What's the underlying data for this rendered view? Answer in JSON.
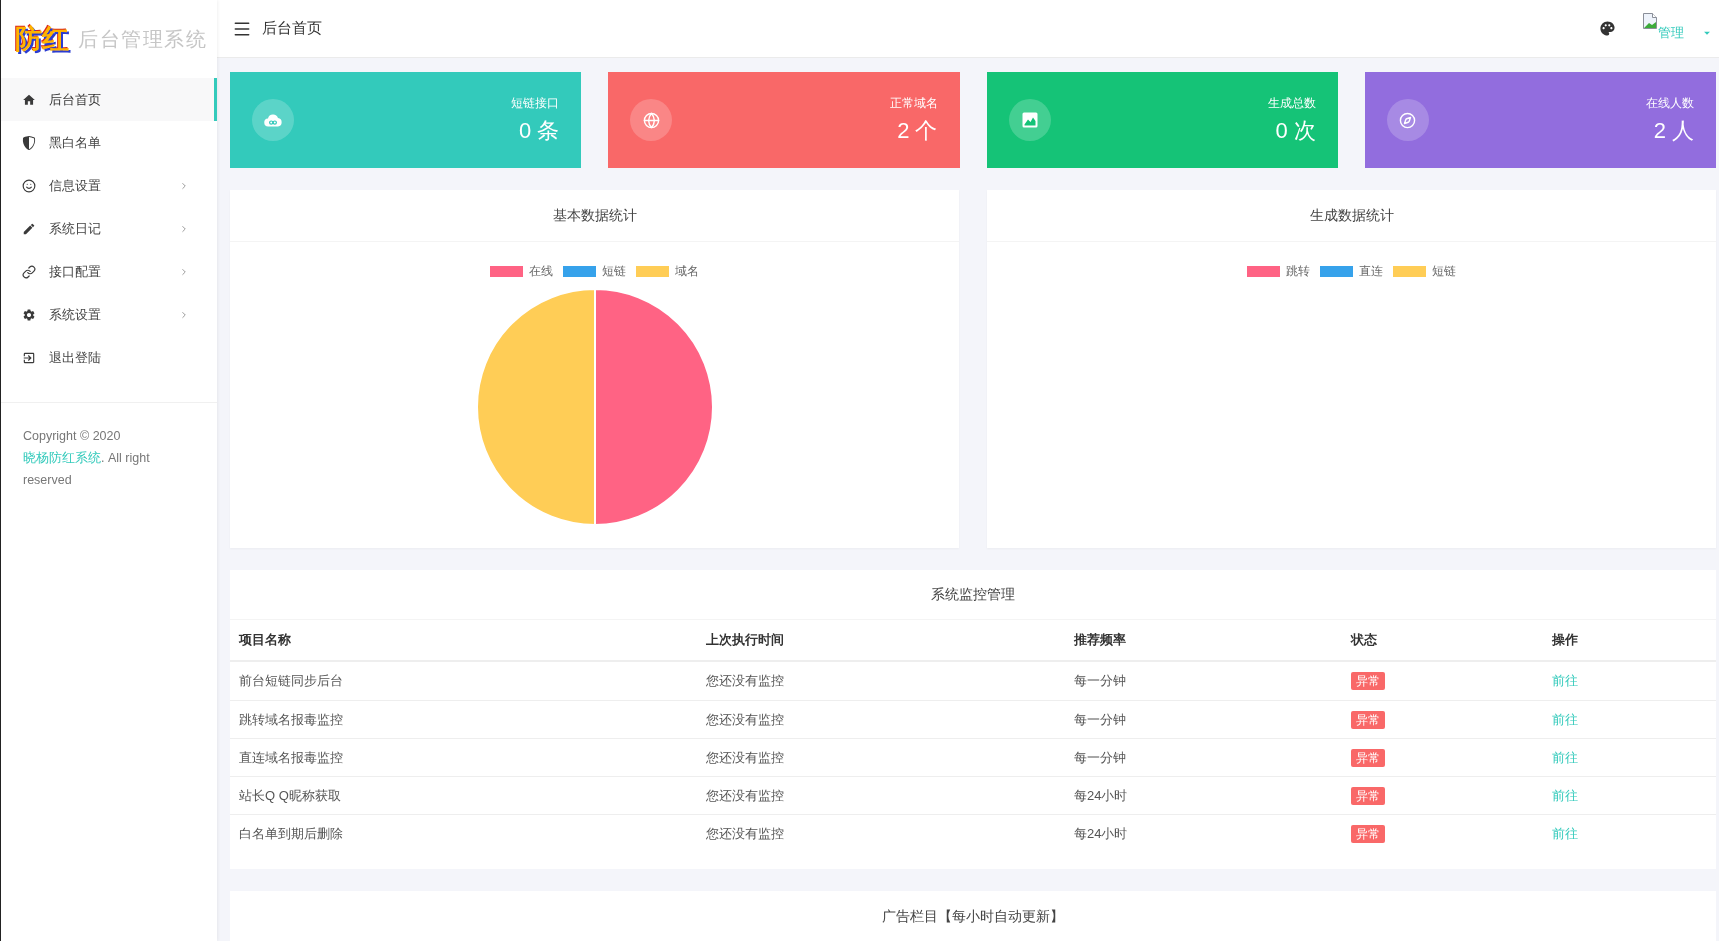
{
  "sidebar": {
    "logo": "防红",
    "title": "后台管理系统",
    "items": [
      {
        "label": "后台首页",
        "selected": true,
        "has_children": false
      },
      {
        "label": "黑白名单",
        "selected": false,
        "has_children": false
      },
      {
        "label": "信息设置",
        "selected": false,
        "has_children": true
      },
      {
        "label": "系统日记",
        "selected": false,
        "has_children": true
      },
      {
        "label": "接口配置",
        "selected": false,
        "has_children": true
      },
      {
        "label": "系统设置",
        "selected": false,
        "has_children": true
      },
      {
        "label": "退出登陆",
        "selected": false,
        "has_children": false
      }
    ],
    "copyright": {
      "text_before": "Copyright © 2020 ",
      "link": "晓杨防红系统",
      "text_after": ". All right reserved"
    }
  },
  "topbar": {
    "page_title": "后台首页",
    "user": "管理"
  },
  "stats": [
    {
      "label": "短链接口",
      "value": "0 条",
      "color": "#33cabb"
    },
    {
      "label": "正常域名",
      "value": "2 个",
      "color": "#f96868"
    },
    {
      "label": "生成总数",
      "value": "0 次",
      "color": "#15c377"
    },
    {
      "label": "在线人数",
      "value": "2 人",
      "color": "#926dde"
    }
  ],
  "charts": [
    {
      "title": "基本数据统计",
      "chart_data": {
        "type": "pie",
        "categories": [
          "在线",
          "短链",
          "域名"
        ],
        "values": [
          50,
          0,
          50
        ],
        "colors": [
          "#ff6384",
          "#36a2eb",
          "#ffcd56"
        ],
        "legend": "top"
      }
    },
    {
      "title": "生成数据统计",
      "legend": [
        {
          "label": "跳转",
          "color": "#ff6384"
        },
        {
          "label": "直连",
          "color": "#36a2eb"
        },
        {
          "label": "短链",
          "color": "#ffcd56"
        }
      ]
    }
  ],
  "monitor": {
    "title": "系统监控管理",
    "columns": [
      "项目名称",
      "上次执行时间",
      "推荐频率",
      "状态",
      "操作"
    ],
    "rows": [
      {
        "name": "前台短链同步后台",
        "last_run": "您还没有监控",
        "frequency": "每一分钟",
        "status": "异常",
        "action": "前往"
      },
      {
        "name": "跳转域名报毒监控",
        "last_run": "您还没有监控",
        "frequency": "每一分钟",
        "status": "异常",
        "action": "前往"
      },
      {
        "name": "直连域名报毒监控",
        "last_run": "您还没有监控",
        "frequency": "每一分钟",
        "status": "异常",
        "action": "前往"
      },
      {
        "name": "站长Q Q昵称获取",
        "last_run": "您还没有监控",
        "frequency": "每24小时",
        "status": "异常",
        "action": "前往"
      },
      {
        "name": "白名单到期后删除",
        "last_run": "您还没有监控",
        "frequency": "每24小时",
        "status": "异常",
        "action": "前往"
      }
    ]
  },
  "ads": {
    "title": "广告栏目【每小时自动更新】"
  }
}
